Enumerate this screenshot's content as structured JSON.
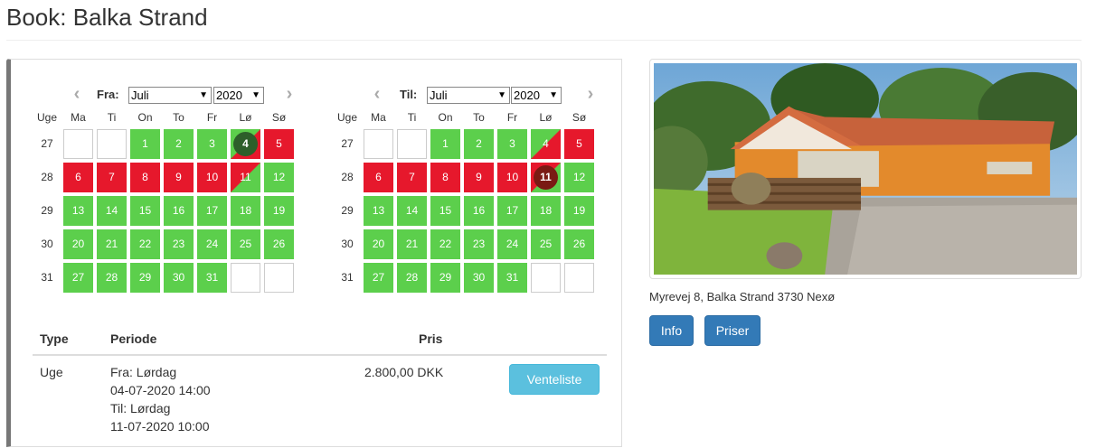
{
  "page": {
    "title": "Book: Balka Strand"
  },
  "calendar_common": {
    "week_label": "Uge",
    "weekdays": [
      "Ma",
      "Ti",
      "On",
      "To",
      "Fr",
      "Lø",
      "Sø"
    ],
    "weeks": [
      "27",
      "28",
      "29",
      "30",
      "31"
    ],
    "prev_icon": "chevron-left-icon",
    "next_icon": "chevron-right-icon"
  },
  "from_calendar": {
    "label": "Fra:",
    "month": "Juli",
    "year": "2020",
    "days": [
      [
        "",
        "",
        "1",
        "2",
        "3",
        "4",
        "5"
      ],
      [
        "6",
        "7",
        "8",
        "9",
        "10",
        "11",
        "12"
      ],
      [
        "13",
        "14",
        "15",
        "16",
        "17",
        "18",
        "19"
      ],
      [
        "20",
        "21",
        "22",
        "23",
        "24",
        "25",
        "26"
      ],
      [
        "27",
        "28",
        "29",
        "30",
        "31",
        "",
        ""
      ]
    ],
    "status": [
      [
        "empty",
        "empty",
        "free",
        "free",
        "free",
        "free-booked",
        "booked"
      ],
      [
        "booked",
        "booked",
        "booked",
        "booked",
        "booked",
        "booked-free",
        "free"
      ],
      [
        "free",
        "free",
        "free",
        "free",
        "free",
        "free",
        "free"
      ],
      [
        "free",
        "free",
        "free",
        "free",
        "free",
        "free",
        "free"
      ],
      [
        "free",
        "free",
        "free",
        "free",
        "free",
        "empty",
        "empty"
      ]
    ],
    "selected_day": "4"
  },
  "to_calendar": {
    "label": "Til:",
    "month": "Juli",
    "year": "2020",
    "days": [
      [
        "",
        "",
        "1",
        "2",
        "3",
        "4",
        "5"
      ],
      [
        "6",
        "7",
        "8",
        "9",
        "10",
        "11",
        "12"
      ],
      [
        "13",
        "14",
        "15",
        "16",
        "17",
        "18",
        "19"
      ],
      [
        "20",
        "21",
        "22",
        "23",
        "24",
        "25",
        "26"
      ],
      [
        "27",
        "28",
        "29",
        "30",
        "31",
        "",
        ""
      ]
    ],
    "status": [
      [
        "empty",
        "empty",
        "free",
        "free",
        "free",
        "free-booked",
        "booked"
      ],
      [
        "booked",
        "booked",
        "booked",
        "booked",
        "booked",
        "booked-free",
        "free"
      ],
      [
        "free",
        "free",
        "free",
        "free",
        "free",
        "free",
        "free"
      ],
      [
        "free",
        "free",
        "free",
        "free",
        "free",
        "free",
        "free"
      ],
      [
        "free",
        "free",
        "free",
        "free",
        "free",
        "empty",
        "empty"
      ]
    ],
    "selected_day": "11"
  },
  "colors": {
    "free": "#5ccf4c",
    "booked": "#e6182c",
    "info": "#5bc0de",
    "primary": "#337ab7"
  },
  "table": {
    "headers": {
      "type": "Type",
      "periode": "Periode",
      "pris": "Pris"
    },
    "row": {
      "type": "Uge",
      "from_label": "Fra: Lørdag",
      "from_datetime": "04-07-2020 14:00",
      "to_label": "Til: Lørdag",
      "to_datetime": "11-07-2020 10:00",
      "price": "2.800,00 DKK",
      "action": "Venteliste"
    }
  },
  "sidebar": {
    "address": "Myrevej 8, Balka Strand 3730 Nexø",
    "info_button": "Info",
    "prices_button": "Priser"
  }
}
